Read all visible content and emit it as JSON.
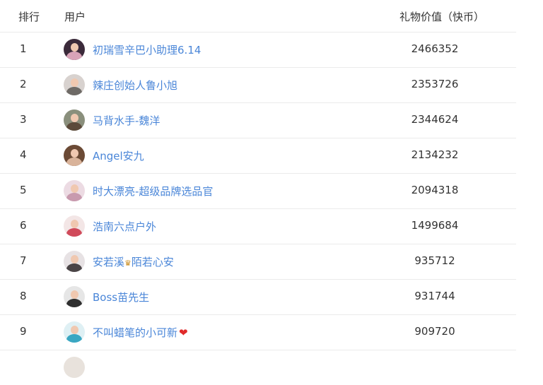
{
  "header": {
    "rank_label": "排行",
    "user_label": "用户",
    "value_label": "礼物价值（快币）"
  },
  "rows": [
    {
      "rank": "1",
      "user_pre": "初瑞雪辛巴小助理6.14",
      "user_post": "",
      "value": "2466352",
      "avatar_bg": "#3b2a3a",
      "avatar_body": "#d9a3b8"
    },
    {
      "rank": "2",
      "user_pre": "辣庄创始人鲁小旭",
      "user_post": "",
      "value": "2353726",
      "avatar_bg": "#d8d2cf",
      "avatar_body": "#6e6a66"
    },
    {
      "rank": "3",
      "user_pre": "马背水手-魏洋",
      "user_post": "",
      "value": "2344624",
      "avatar_bg": "#8a8f7c",
      "avatar_body": "#5c4a3a"
    },
    {
      "rank": "4",
      "user_pre": "Angel安九",
      "user_post": "",
      "value": "2134232",
      "avatar_bg": "#6b4a35",
      "avatar_body": "#d9b39a"
    },
    {
      "rank": "5",
      "user_pre": "时大漂亮-超级品牌选品官",
      "user_post": "",
      "value": "2094318",
      "avatar_bg": "#ecdbe3",
      "avatar_body": "#c89aae"
    },
    {
      "rank": "6",
      "user_pre": "浩南六点户外",
      "user_post": "",
      "value": "1499684",
      "avatar_bg": "#f3e6e6",
      "avatar_body": "#d04a5a"
    },
    {
      "rank": "7",
      "user_pre": "安若溪",
      "user_post": "陌若心安",
      "value": "935712",
      "avatar_bg": "#e7e2e4",
      "avatar_body": "#4a4446"
    },
    {
      "rank": "8",
      "user_pre": "Boss苗先生",
      "user_post": "",
      "value": "931744",
      "avatar_bg": "#e6e6e6",
      "avatar_body": "#2e2e2e"
    },
    {
      "rank": "9",
      "user_pre": "不叫蜡笔的小可新",
      "user_post": "",
      "value": "909720",
      "avatar_bg": "#dff0f4",
      "avatar_body": "#3aa7c2"
    }
  ],
  "icons": {
    "heart": "❤",
    "crown": "♛"
  },
  "colors": {
    "link": "#4a86d8",
    "text": "#333333",
    "divider": "#ebebeb",
    "heart": "#e02a2a"
  }
}
